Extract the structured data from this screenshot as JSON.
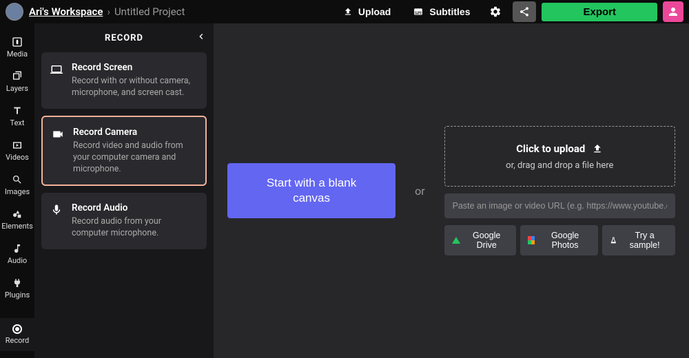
{
  "header": {
    "workspace": "Ari's Workspace",
    "project": "Untitled Project",
    "upload": "Upload",
    "subtitles": "Subtitles",
    "export": "Export"
  },
  "rail": {
    "media": "Media",
    "layers": "Layers",
    "text": "Text",
    "videos": "Videos",
    "images": "Images",
    "elements": "Elements",
    "audio": "Audio",
    "plugins": "Plugins",
    "record": "Record"
  },
  "panel": {
    "title": "RECORD",
    "cards": [
      {
        "title": "Record Screen",
        "desc": "Record with or without camera, microphone, and screen cast."
      },
      {
        "title": "Record Camera",
        "desc": "Record video and audio from your computer camera and microphone."
      },
      {
        "title": "Record Audio",
        "desc": "Record audio from your computer microphone."
      }
    ]
  },
  "canvas": {
    "blank": "Start with a blank canvas",
    "or": "or",
    "dropzone_title": "Click to upload",
    "dropzone_sub": "or, drag and drop a file here",
    "url_placeholder": "Paste an image or video URL (e.g. https://www.youtube.com/v",
    "drive": "Google Drive",
    "photos": "Google Photos",
    "sample": "Try a sample!"
  }
}
